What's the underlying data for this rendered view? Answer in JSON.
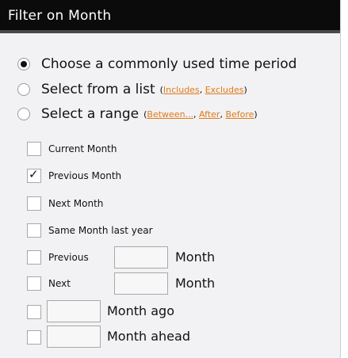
{
  "dialog": {
    "title": "Filter on Month",
    "radio_options": [
      {
        "label": "Choose a commonly used time period",
        "selected": true
      },
      {
        "label": "Select from a list",
        "selected": false,
        "links": [
          "Includes",
          "Excludes"
        ]
      },
      {
        "label": "Select a range",
        "selected": false,
        "links": [
          "Between...",
          "After",
          "Before"
        ]
      }
    ],
    "checkbox_options": [
      {
        "label": "Current Month",
        "checked": false
      },
      {
        "label": "Previous Month",
        "checked": true
      },
      {
        "label": "Next Month",
        "checked": false
      },
      {
        "label": "Same Month last year",
        "checked": false
      },
      {
        "label": "Previous",
        "checked": false,
        "input_value": "",
        "unit": "Month"
      },
      {
        "label": "Next",
        "checked": false,
        "input_value": "",
        "unit": "Month"
      },
      {
        "label": "",
        "checked": false,
        "input_value": "",
        "unit": "Month ago"
      },
      {
        "label": "",
        "checked": false,
        "input_value": "",
        "unit": "Month ahead"
      }
    ],
    "link_color": "#e07a1a"
  }
}
